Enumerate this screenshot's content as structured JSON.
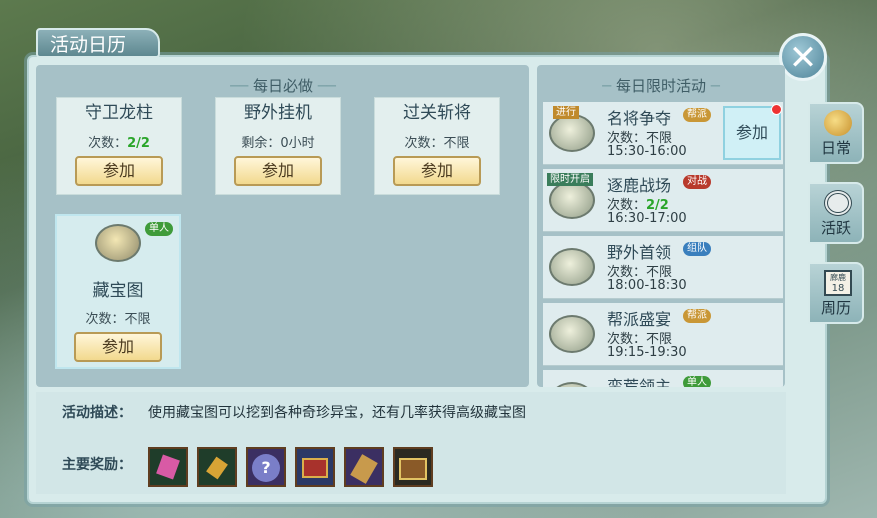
{
  "window": {
    "title": "活动日历"
  },
  "daily": {
    "header": "每日必做",
    "cards": [
      {
        "title": "守卫龙柱",
        "count_label": "次数：",
        "count_value": "2/2",
        "button": "参加"
      },
      {
        "title": "野外挂机",
        "count_label": "剩余：",
        "count_value": "0小时",
        "button": "参加"
      },
      {
        "title": "过关斩将",
        "count_label": "次数：",
        "count_value": "不限",
        "button": "参加"
      },
      {
        "title": "藏宝图",
        "tag": "单人",
        "count_label": "次数：",
        "count_value": "不限",
        "button": "参加"
      }
    ]
  },
  "timed": {
    "header": "每日限时活动",
    "rows": [
      {
        "ribbon": "进行",
        "name": "名将争夺",
        "tag": "帮派",
        "count_label": "次数：",
        "count_value": "不限",
        "time": "15:30-16:00",
        "button": "参加"
      },
      {
        "ribbon": "限时开启",
        "name": "逐鹿战场",
        "tag": "对战",
        "count_label": "次数：",
        "count_value": "2/2",
        "time": "16:30-17:00"
      },
      {
        "name": "野外首领",
        "tag": "组队",
        "count_label": "次数：",
        "count_value": "不限",
        "time": "18:00-18:30"
      },
      {
        "name": "帮派盛宴",
        "tag": "帮派",
        "count_label": "次数：",
        "count_value": "不限",
        "time": "19:15-19:30"
      },
      {
        "name": "蛮荒领主",
        "tag": "单人"
      }
    ]
  },
  "side_tabs": [
    {
      "label": "日常",
      "icon": "daily-icon"
    },
    {
      "label": "活跃",
      "icon": "target-icon"
    },
    {
      "label": "周历",
      "icon": "calendar-icon",
      "calendar_month": "廊鹿",
      "calendar_day": "18"
    }
  ],
  "description": {
    "label": "活动描述：",
    "text": "使用藏宝图可以挖到各种奇珍异宝，还有几率获得高级藏宝图"
  },
  "rewards": {
    "label": "主要奖励：",
    "items": [
      {
        "icon": "pink-crystal-icon",
        "color": "#d85aa5"
      },
      {
        "icon": "gold-gem-icon",
        "color": "#d8a435"
      },
      {
        "icon": "mystery-orb-icon",
        "color": "#7a7ec8"
      },
      {
        "icon": "red-chest-icon",
        "color": "#a8322c"
      },
      {
        "icon": "scroll-icon",
        "color": "#c89a4c"
      },
      {
        "icon": "treasure-chest-icon",
        "color": "#8a5a28"
      }
    ]
  }
}
